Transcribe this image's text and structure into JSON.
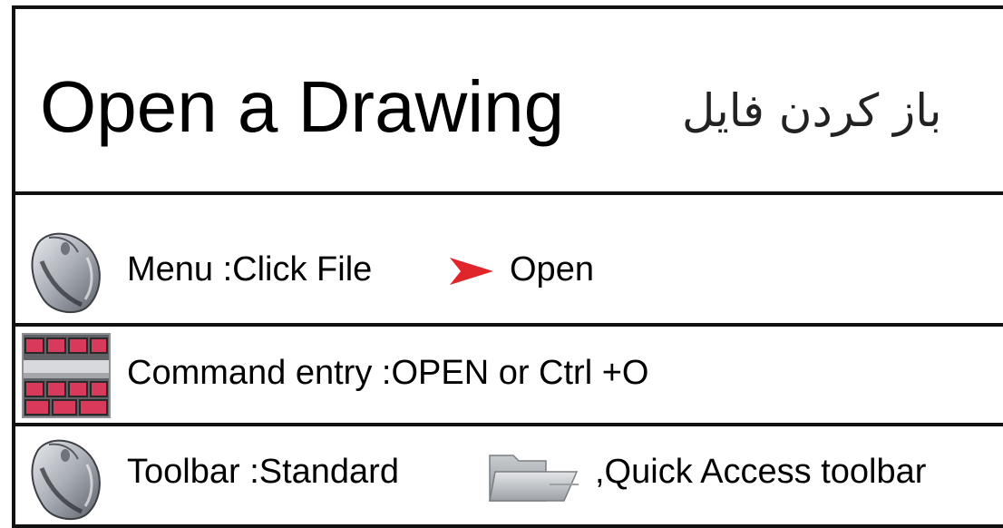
{
  "header": {
    "title_en": "Open a Drawing",
    "title_fa": "باز کردن فایل"
  },
  "rows": [
    {
      "icon": "mouse-icon",
      "label": "Menu :Click File",
      "arrow": "red-arrow-icon",
      "target": "Open"
    },
    {
      "icon": "keyboard-icon",
      "label": "Command entry :OPEN or Ctrl  +O"
    },
    {
      "icon": "mouse-icon",
      "label": "Toolbar :Standard",
      "tool_icon": "folder-open-icon",
      "suffix": ",Quick Access toolbar"
    }
  ],
  "colors": {
    "border": "#111111",
    "arrow": "#e0262b",
    "keyboard_key": "#d83a5c",
    "keyboard_frame": "#6b6b6b"
  }
}
